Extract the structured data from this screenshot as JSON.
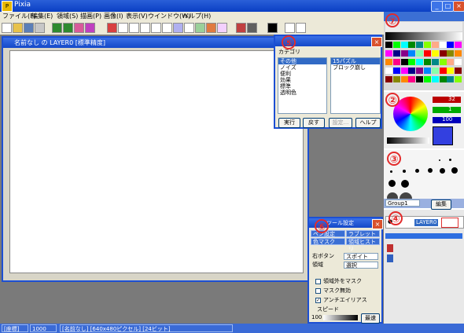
{
  "app": {
    "title": "Pixia",
    "logo": "P"
  },
  "menubar": [
    "ファイル(F)",
    "編集(E)",
    "領域(S)",
    "描画(P)",
    "画像(I)",
    "表示(V)",
    "ウインドウ(W)",
    "ヘルプ(H)"
  ],
  "canvas_window": {
    "title": "名前なし の LAYER0 [標準精度]"
  },
  "filter_dialog": {
    "label": "カテゴリ",
    "categories": [
      "その他",
      "ノイズ",
      "便利",
      "効果",
      "標準",
      "透明色"
    ],
    "selected_category": "その他",
    "filters": [
      "15パズル",
      "ブロック崩し"
    ],
    "selected_filter": "15パズル",
    "buttons": [
      "実行",
      "戻す",
      "設定...",
      "ヘルプ"
    ]
  },
  "tool_dialog": {
    "title": "ツール設定",
    "tabs": [
      "ペン設定",
      "ラブレット",
      "色マスク",
      "領域ヒストリ"
    ],
    "right_button_label": "右ボタン",
    "right_button_value": "スポイト",
    "area_label": "領域",
    "area_value": "選択",
    "checkboxes": [
      {
        "label": "領域外をマスク",
        "checked": false
      },
      {
        "label": "マスク無効",
        "checked": false
      },
      {
        "label": "アンチエイリアス",
        "checked": true
      }
    ],
    "speed_label": "スピード",
    "speed_value": "100",
    "speed_button": "最速"
  },
  "right_panel": {
    "rgb_values": [
      "32",
      "1",
      "100"
    ],
    "brush_group": "Group1",
    "brush_edit": "編集",
    "layer_name": "LAYER0"
  },
  "annotations": [
    "⑤",
    "⑥",
    "⑦",
    "②",
    "③",
    "④"
  ],
  "statusbar": {
    "mode": "[座標]",
    "zoom": "1000",
    "info": "[名前なし] [640x480ピクセル] [24ビット]"
  },
  "colors": {
    "titlebar": "#1448c8",
    "menubar": "#ece9d8",
    "annotation": "#e32b2b"
  }
}
